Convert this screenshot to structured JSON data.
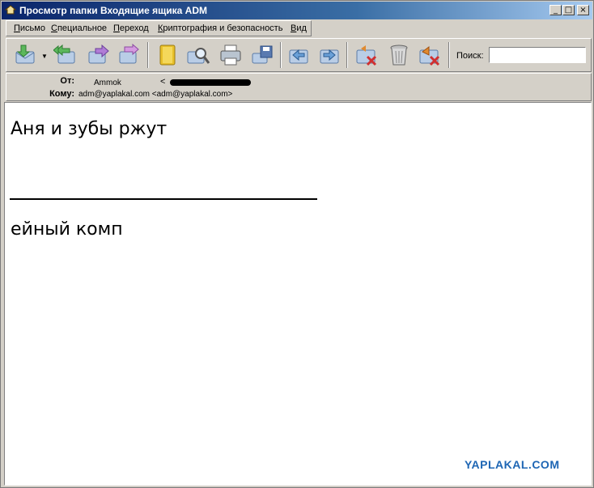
{
  "window": {
    "title": "Просмотр папки Входящие ящика ADM",
    "minimize": "_",
    "maximize": "□",
    "close": "×"
  },
  "menu": [
    {
      "label_u": "П",
      "label_rest": "исьмо"
    },
    {
      "label_u": "С",
      "label_rest": "пециальное"
    },
    {
      "label_u": "П",
      "label_rest": "ереход"
    },
    {
      "label_u": "К",
      "label_rest": "риптография и безопасность"
    },
    {
      "label_u": "В",
      "label_rest": "ид"
    }
  ],
  "toolbar": {
    "search_label": "Поиск:",
    "search_value": "",
    "icons": [
      "get-mail-icon",
      "reply-all-icon",
      "forward-icon",
      "redirect-icon",
      "address-book-icon",
      "find-icon",
      "print-icon",
      "save-icon",
      "previous-icon",
      "next-icon",
      "delete-icon",
      "trash-icon",
      "junk-icon"
    ]
  },
  "headers": {
    "from_label": "От:",
    "from_value": "Ammok",
    "from_open": "<",
    "to_label": "Кому:",
    "to_value": "adm@yaplakal.com <adm@yaplakal.com>"
  },
  "message": {
    "line1": "Аня и зубы ржут",
    "line2": "ейный комп"
  },
  "watermark": "YAPLAKAL.COM"
}
